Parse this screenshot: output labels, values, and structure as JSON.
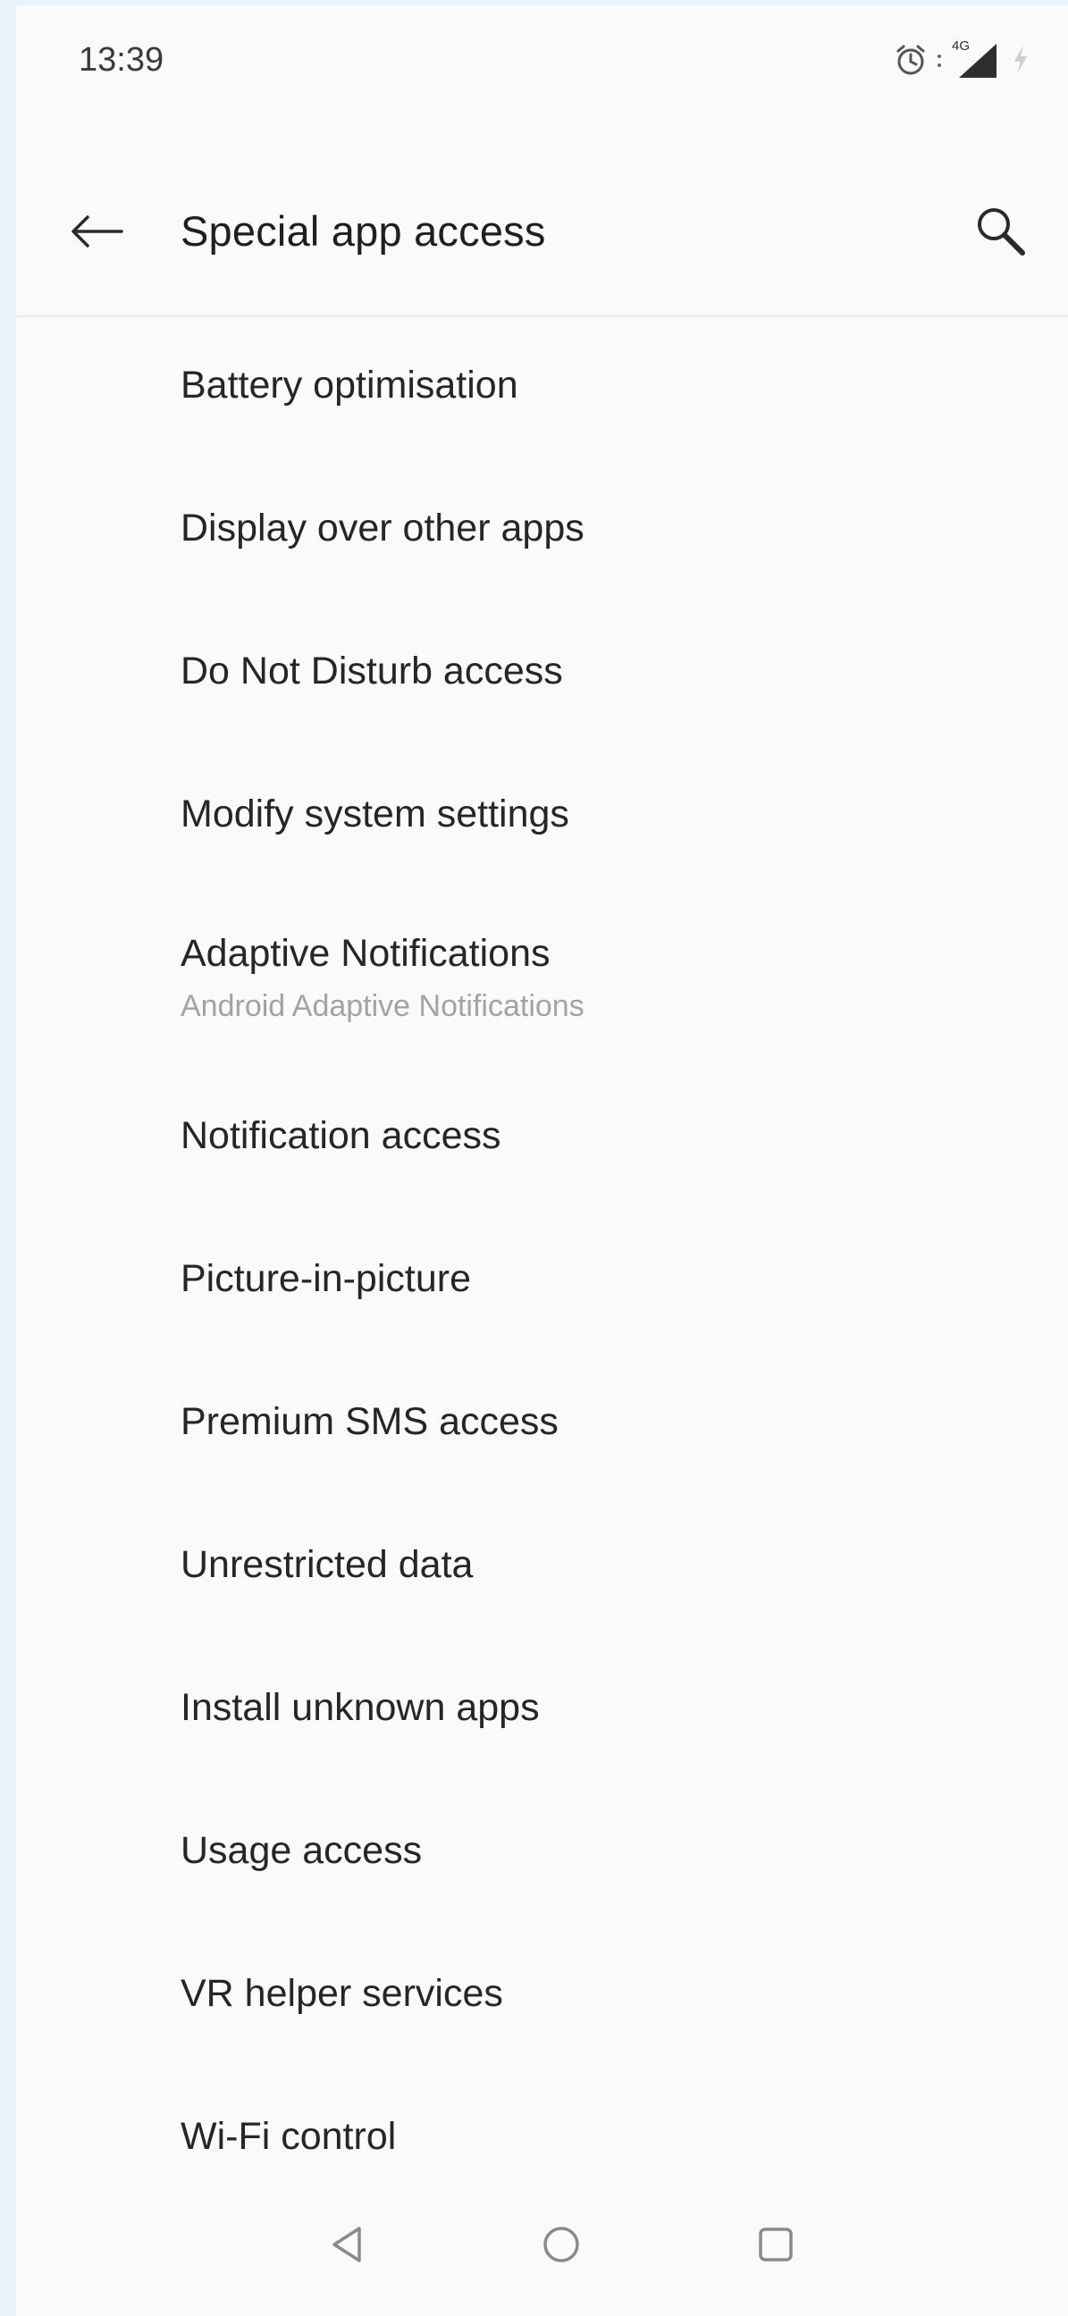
{
  "status_bar": {
    "time": "13:39",
    "network_label": "4G",
    "icons": [
      "alarm-icon",
      "signal-icon",
      "charging-icon"
    ]
  },
  "toolbar": {
    "title": "Special app access",
    "back_icon": "arrow-left-icon",
    "search_icon": "search-icon"
  },
  "items": [
    {
      "title": "Battery optimisation"
    },
    {
      "title": "Display over other apps"
    },
    {
      "title": "Do Not Disturb access"
    },
    {
      "title": "Modify system settings"
    },
    {
      "title": "Adaptive Notifications",
      "subtitle": "Android Adaptive Notifications"
    },
    {
      "title": "Notification access"
    },
    {
      "title": "Picture-in-picture"
    },
    {
      "title": "Premium SMS access"
    },
    {
      "title": "Unrestricted data"
    },
    {
      "title": "Install unknown apps"
    },
    {
      "title": "Usage access"
    },
    {
      "title": "VR helper services"
    },
    {
      "title": "Wi-Fi control"
    }
  ],
  "nav_bar": {
    "icons": [
      "nav-back-icon",
      "nav-home-icon",
      "nav-recents-icon"
    ]
  },
  "colors": {
    "background": "#fafafa",
    "outer_background": "#eaf3fc",
    "title_text": "#1f1f1f",
    "item_text": "#262626",
    "subtitle_text": "#a3a3a3",
    "divider": "#ececec"
  }
}
